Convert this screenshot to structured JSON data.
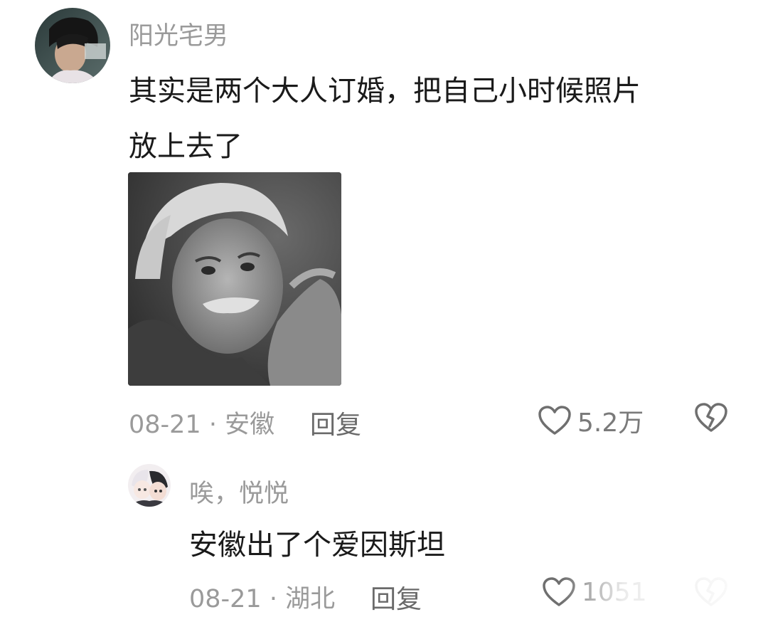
{
  "comments": [
    {
      "username": "阳光宅男",
      "text_lines": [
        "其实是两个大人订婚，把自己小时候照片",
        "放上去了"
      ],
      "date": "08-21",
      "location": "安徽",
      "meta_separator": " · ",
      "reply_label": "回复",
      "likes": "5.2万",
      "avatar_icon": "user-avatar-photo",
      "image_description_icon": "portrait-photo"
    },
    {
      "username": "唉，悦悦",
      "text": "安徽出了个爱因斯坦",
      "date": "08-21",
      "location": "湖北",
      "meta_separator": " · ",
      "reply_label": "回复",
      "likes": "1051",
      "avatar_icon": "anime-avatar"
    }
  ],
  "icons": {
    "like": "heart-outline-icon",
    "dislike": "broken-heart-icon"
  },
  "colors": {
    "text_primary": "#1a1a1a",
    "text_secondary": "#9a9a9a",
    "icon_gray": "#6f6f6f"
  }
}
